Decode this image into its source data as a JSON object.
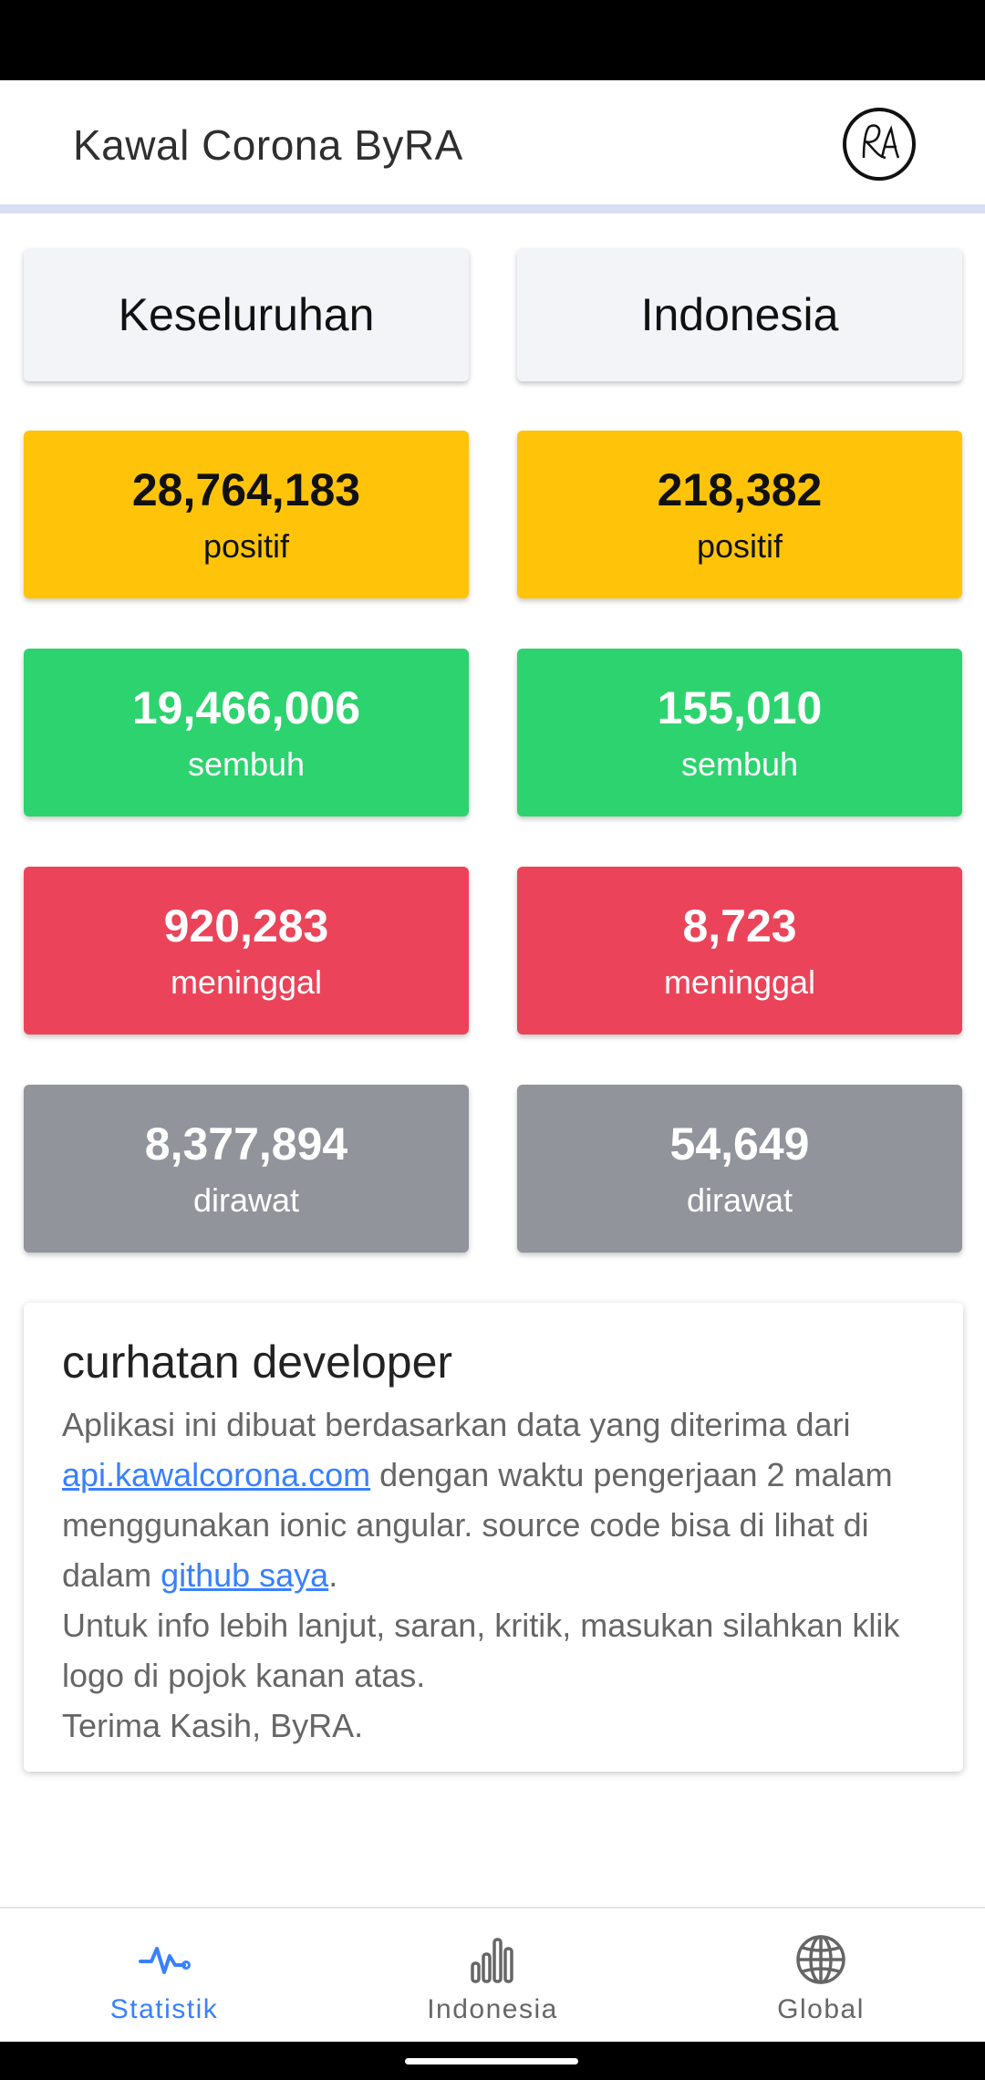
{
  "header": {
    "title": "Kawal Corona ByRA",
    "logo_text": "RA"
  },
  "columns": {
    "left": {
      "title": "Keseluruhan",
      "stats": [
        {
          "value": "28,764,183",
          "label": "positif",
          "color": "#ffc409"
        },
        {
          "value": "19,466,006",
          "label": "sembuh",
          "color": "#2dd36f"
        },
        {
          "value": "920,283",
          "label": "meninggal",
          "color": "#eb445a"
        },
        {
          "value": "8,377,894",
          "label": "dirawat",
          "color": "#92949c"
        }
      ]
    },
    "right": {
      "title": "Indonesia",
      "stats": [
        {
          "value": "218,382",
          "label": "positif",
          "color": "#ffc409"
        },
        {
          "value": "155,010",
          "label": "sembuh",
          "color": "#2dd36f"
        },
        {
          "value": "8,723",
          "label": "meninggal",
          "color": "#eb445a"
        },
        {
          "value": "54,649",
          "label": "dirawat",
          "color": "#92949c"
        }
      ]
    }
  },
  "developer_note": {
    "title": "curhatan developer",
    "text_1": "Aplikasi ini dibuat berdasarkan data yang diterima dari ",
    "link_api": "api.kawalcorona.com",
    "text_2": " dengan waktu pengerjaan 2 malam menggunakan ionic angular. source code bisa di lihat di dalam ",
    "link_github": "github saya",
    "text_3": ".",
    "line_2": "Untuk info lebih lanjut, saran, kritik, masukan silahkan klik logo di pojok kanan atas.",
    "line_3": "Terima Kasih, ByRA."
  },
  "tabs": [
    {
      "label": "Statistik",
      "icon": "pulse-icon",
      "active": true
    },
    {
      "label": "Indonesia",
      "icon": "bar-chart-icon",
      "active": false
    },
    {
      "label": "Global",
      "icon": "globe-icon",
      "active": false
    }
  ],
  "colors": {
    "accent": "#3880ff",
    "positif": "#ffc409",
    "sembuh": "#2dd36f",
    "meninggal": "#eb445a",
    "dirawat": "#92949c"
  }
}
